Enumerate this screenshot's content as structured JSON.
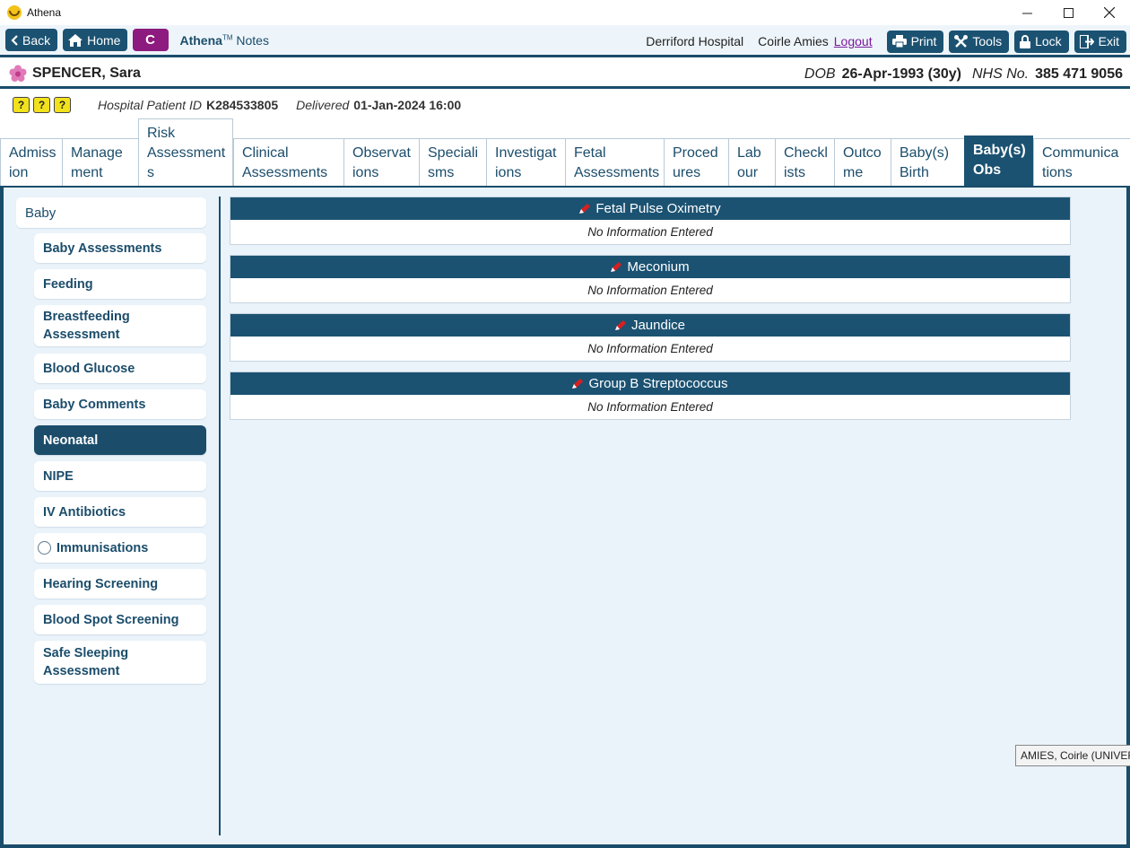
{
  "window": {
    "title": "Athena",
    "minimize": "—",
    "maximize": "☐",
    "close": "✕"
  },
  "toolbar": {
    "back": "Back",
    "home": "Home",
    "c_label": "C",
    "app_name": "Athena",
    "app_tm": "TM",
    "app_suffix": "Notes",
    "hospital": "Derriford Hospital",
    "user": "Coirle Amies",
    "logout": "Logout",
    "print": "Print",
    "tools": "Tools",
    "lock": "Lock",
    "exit": "Exit"
  },
  "patient": {
    "name": "SPENCER, Sara",
    "dob_label": "DOB",
    "dob_value": "26-Apr-1993 (30y)",
    "nhs_label": "NHS No.",
    "nhs_value": "385 471 9056"
  },
  "info": {
    "alerts": [
      "?",
      "?",
      "?"
    ],
    "hospital_id_label": "Hospital Patient ID",
    "hospital_id_value": "K284533805",
    "delivered_label": "Delivered",
    "delivered_value": "01-Jan-2024 16:00"
  },
  "tabs": [
    {
      "line1": "Admiss",
      "line2": "ion"
    },
    {
      "line1": "Manage",
      "line2": "ment"
    },
    {
      "line1": "Risk",
      "line2": "Assessment",
      "line3": "s"
    },
    {
      "line1": "Clinical",
      "line2": "Assessments"
    },
    {
      "line1": "Observat",
      "line2": "ions"
    },
    {
      "line1": "Speciali",
      "line2": "sms"
    },
    {
      "line1": "Investigat",
      "line2": "ions"
    },
    {
      "line1": "Fetal",
      "line2": "Assessments"
    },
    {
      "line1": "Proced",
      "line2": "ures"
    },
    {
      "line1": "Lab",
      "line2": "our"
    },
    {
      "line1": "Checkl",
      "line2": "ists"
    },
    {
      "line1": "Outco",
      "line2": "me"
    },
    {
      "line1": "Baby(s)",
      "line2": "Birth"
    },
    {
      "line1": "Baby(s)",
      "line2": "Obs"
    },
    {
      "line1": "Communica",
      "line2": "tions"
    }
  ],
  "sidebar": {
    "header": "Baby",
    "items": [
      {
        "line1": "Baby Assessments"
      },
      {
        "line1": "Feeding"
      },
      {
        "line1": "Breastfeeding",
        "line2": "Assessment"
      },
      {
        "line1": "Blood Glucose"
      },
      {
        "line1": "Baby Comments"
      },
      {
        "line1": "Neonatal",
        "active": true
      },
      {
        "line1": "NIPE"
      },
      {
        "line1": "IV Antibiotics"
      },
      {
        "line1": "Immunisations",
        "radio": true
      },
      {
        "line1": "Hearing Screening"
      },
      {
        "line1": "Blood Spot Screening"
      },
      {
        "line1": "Safe Sleeping",
        "line2": "Assessment"
      }
    ]
  },
  "sections": [
    {
      "title": "Fetal Pulse Oximetry",
      "body": "No Information Entered"
    },
    {
      "title": "Meconium",
      "body": "No Information Entered"
    },
    {
      "title": "Jaundice",
      "body": "No Information Entered"
    },
    {
      "title": "Group B Streptococcus",
      "body": "No Information Entered"
    }
  ],
  "tooltip": "AMIES, Coirle (UNIVERSITY",
  "colors": {
    "navy": "#1b5272",
    "panel": "#eaf3fa",
    "c_button": "#8d1a7e",
    "alert": "#f2e21b"
  }
}
